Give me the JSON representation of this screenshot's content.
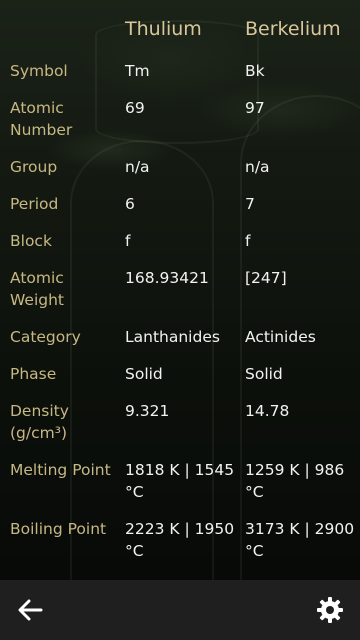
{
  "elements": {
    "a": "Thulium",
    "b": "Berkelium"
  },
  "rows": [
    {
      "label": "Symbol",
      "a": "Tm",
      "b": "Bk"
    },
    {
      "label": "Atomic Number",
      "a": "69",
      "b": "97"
    },
    {
      "label": "Group",
      "a": "n/a",
      "b": "n/a"
    },
    {
      "label": "Period",
      "a": "6",
      "b": "7"
    },
    {
      "label": "Block",
      "a": "f",
      "b": "f"
    },
    {
      "label": "Atomic Weight",
      "a": "168.93421",
      "b": "[247]"
    },
    {
      "label": "Category",
      "a": "Lanthanides",
      "b": "Actinides"
    },
    {
      "label": "Phase",
      "a": "Solid",
      "b": "Solid"
    },
    {
      "label": "Density (g/cm³)",
      "a": "9.321",
      "b": "14.78"
    },
    {
      "label": "Melting Point",
      "a": "1818 K | 1545 °C",
      "b": "1259 K | 986 °C"
    },
    {
      "label": "Boiling Point",
      "a": "2223 K | 1950 °C",
      "b": "3173 K | 2900 °C"
    }
  ],
  "appbar": {
    "back_icon": "arrow-left-icon",
    "settings_icon": "gear-icon"
  },
  "colors": {
    "label": "#c7b883",
    "header": "#d8c79a",
    "value": "#f2f2f2",
    "appbar": "#1f1f1f"
  }
}
